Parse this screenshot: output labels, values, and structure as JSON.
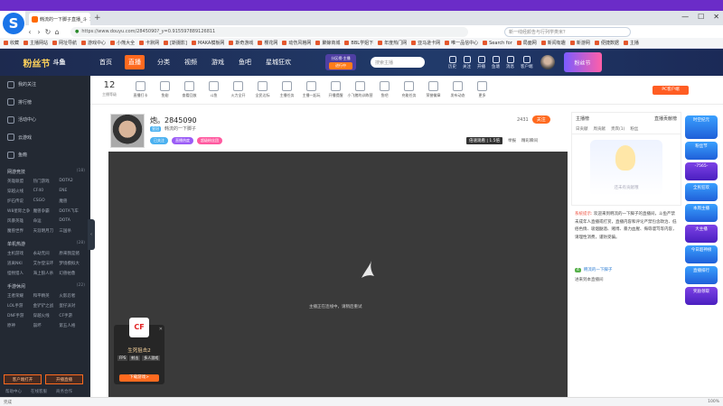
{
  "browser": {
    "tab_title": "韩流的一下脚子直播_斗",
    "url": "https://www.douyu.com/2845090?_y=0.915597889126811",
    "search_placeholder": "新一线经颜告与行列学类米？",
    "bookmarks": [
      "收藏",
      "主播网站",
      "网址导航",
      "游戏中心",
      "小熊大全",
      "卡默网",
      "[斯摄影]",
      "MAKA模板网",
      "斯奇游戏",
      "樱花网",
      "动伤风格网",
      "聚鲸商城",
      "BBL学姐下",
      "年度热门网",
      "亚马逊卡网",
      "唯一品信中心",
      "Search for",
      "局面网",
      "新闻有趣",
      "新游网",
      "便捷数据",
      "主播"
    ]
  },
  "site": {
    "logo_text": "粉丝节",
    "logo_sub": "斗鱼",
    "nav": [
      "首页",
      "直播",
      "分类",
      "视频",
      "游戏",
      "鱼吧",
      "星城狂欢"
    ],
    "active_nav": "直播",
    "upload_top": "分区榜·主播",
    "upload_btn": "进行中",
    "search_placeholder": "搜索主播",
    "icons": [
      "历史",
      "关注",
      "开播",
      "鱼塘",
      "消息",
      "客户端"
    ],
    "promo": "粉丝节"
  },
  "sidebar": {
    "items": [
      "我的关注",
      "排行榜",
      "活动中心",
      "云游戏",
      "鱼瘾"
    ],
    "sections": [
      {
        "title": "网游竞技",
        "more": "(18)",
        "games": [
          "英雄联盟",
          "热门游戏",
          "DOTA2",
          "穿越火线",
          "CF40",
          "ENE",
          "炉石传说",
          "CSGO",
          "魔兽",
          "W8星际之争",
          "魔兽争霸",
          "DOTA飞车",
          "风暴英雄",
          "命运",
          "DOTA",
          "魔兽世界",
          "天涯明月刀",
          "三国杀"
        ]
      },
      {
        "title": "单机热游",
        "more": "(28)",
        "games": [
          "主机游戏",
          "永劫无间",
          "原来我是猪",
          "逃离NKI",
          "艾尔登法环",
          "梦境模拟大",
          "怪物猎人",
          "海上狼人杀",
          "幻兽帕鲁"
        ]
      },
      {
        "title": "手游休闲",
        "more": "(22)",
        "games": [
          "王者荣耀",
          "和平精英",
          "火影忍者",
          "LOL手游",
          "金铲铲之战",
          "蛋仔派对",
          "DNF手游",
          "穿越火线",
          "CF手游",
          "原神",
          "崩坏",
          "第五人格"
        ]
      }
    ],
    "btn_download": "客户端打开",
    "btn_open": "开播直播",
    "footer": [
      "帮助中心",
      "在线客服",
      "商务合作"
    ]
  },
  "category_bar": {
    "level": "12",
    "level_label": "主播等级",
    "items": [
      "直播打卡",
      "鱼翅",
      "查看回放",
      "斗鱼",
      "火力全开",
      "全民达标",
      "主播任务",
      "主播一起玩",
      "开播提醒",
      "小飞猪的训练营",
      "鱼吧",
      "充能任务",
      "荣誉徽章",
      "发布动态",
      "更多"
    ],
    "pc_btn": "PC客户端"
  },
  "streamer": {
    "name": "炮。2845090",
    "sub_tag": "皇冠",
    "category": "韩流的一下脚子",
    "fans": "2431",
    "follow": "关注",
    "badges": [
      "已关注",
      "直播热度",
      "超级粉丝团"
    ],
    "tools": [
      "倍速观看 | 1.5倍",
      "举报",
      "精彩瞬间"
    ]
  },
  "player": {
    "loading_text": "主播正在连线中，请稍后重试"
  },
  "ad_card": {
    "logo": "CF",
    "title": "生死狙击2",
    "tags": [
      "FPS",
      "射击",
      "多人游戏"
    ],
    "button": "下载游戏>"
  },
  "rank_panel": {
    "title": "主播榜",
    "right": "直播贡献榜",
    "tabs": [
      "日贡献",
      "周贡献",
      "贵宾(1)",
      "粉丝"
    ],
    "empty_text": "还未有贡献哦"
  },
  "chat": {
    "system_label": "系统提示:",
    "system_text": "欢迎来到韩流的一下脚子的直播间，斗鱼严禁未成年人直播或打赏，直播内容和评论严禁包含政治、低俗色情、吸烟酗酒、赌博、暴力血腥、侮辱谩骂等内容，请理性消费，谨防受骗。",
    "user_level": "4",
    "user_name": "韩流的一下脚子",
    "enter_text": "进来到本直播间"
  },
  "right_ads": [
    "时空纪元",
    "粉丝节",
    "-7565-",
    "全民狂欢",
    "本周主播",
    "大主播",
    "今日超神榜",
    "直播排行",
    "奖励领取"
  ],
  "statusbar": {
    "left": "完成",
    "right": [
      "100%"
    ]
  }
}
